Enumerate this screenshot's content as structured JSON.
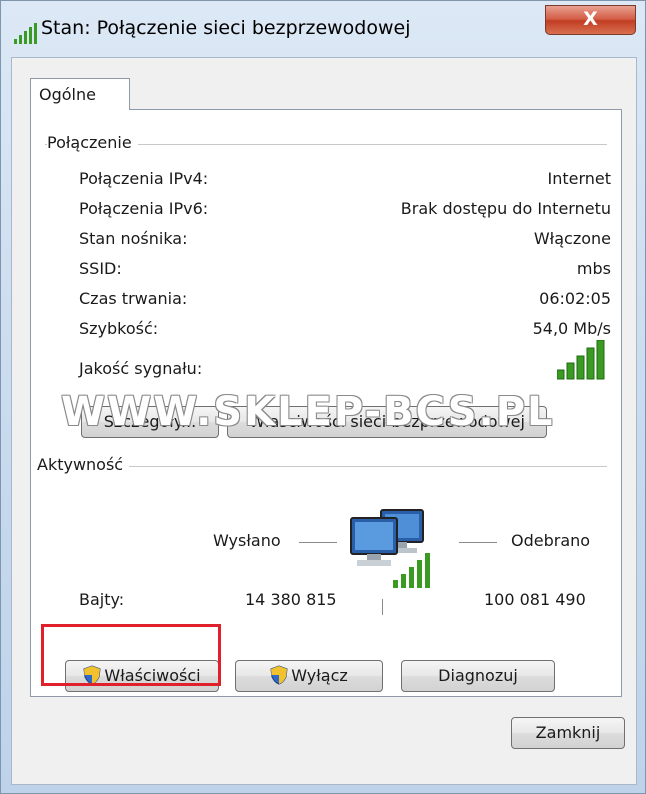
{
  "window": {
    "title": "Stan: Połączenie sieci bezprzewodowej",
    "close_label": "X"
  },
  "tabs": [
    {
      "label": "Ogólne"
    }
  ],
  "connection": {
    "group_title": "Połączenie",
    "rows": [
      {
        "label": "Połączenia IPv4:",
        "value": "Internet"
      },
      {
        "label": "Połączenia IPv6:",
        "value": "Brak dostępu do Internetu"
      },
      {
        "label": "Stan nośnika:",
        "value": "Włączone"
      },
      {
        "label": "SSID:",
        "value": "mbs"
      },
      {
        "label": "Czas trwania:",
        "value": "06:02:05"
      },
      {
        "label": "Szybkość:",
        "value": "54,0 Mb/s"
      }
    ],
    "signal_label": "Jakość sygnału:",
    "signal_bars": 5,
    "signal_level": 5,
    "details_button": "Szczegóły...",
    "wireless_properties_button": "Właściwości sieci bezprzewodowej"
  },
  "activity": {
    "group_title": "Aktywność",
    "sent_label": "Wysłano",
    "received_label": "Odebrano",
    "bytes_label": "Bajty:",
    "bytes_sent": "14 380 815",
    "bytes_received": "100 081 490"
  },
  "buttons": {
    "properties": "Właściwości",
    "disable": "Wyłącz",
    "diagnose": "Diagnozuj",
    "close": "Zamknij"
  },
  "watermark": "WWW.SKLEP-BCS.PL",
  "colors": {
    "signal_green": "#3a9a22",
    "highlight_red": "#e0202a",
    "title_close_red": "#c13c22"
  },
  "icons": {
    "title": "signal-bars-icon",
    "network": "network-computers-icon",
    "uac": "uac-shield-icon"
  }
}
